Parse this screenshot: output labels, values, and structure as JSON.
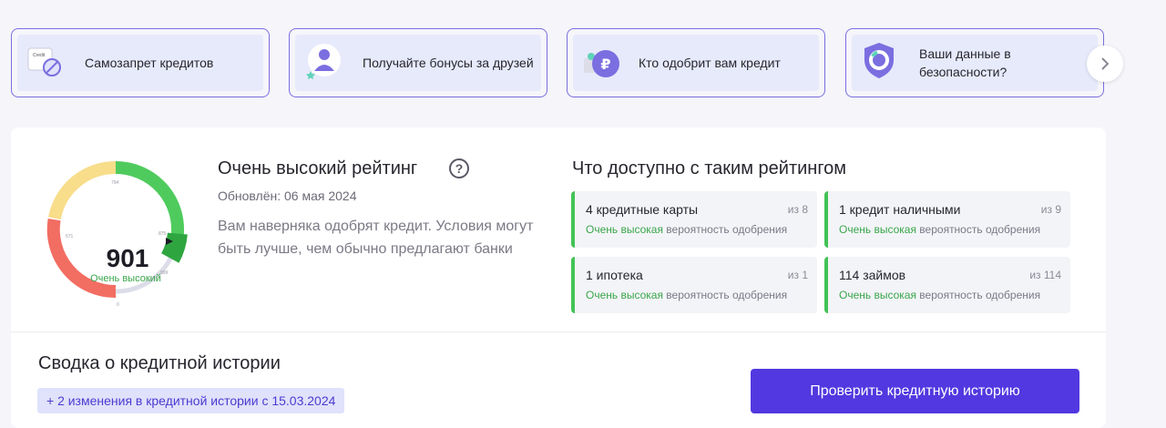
{
  "cards": [
    {
      "icon": "credit-ban-icon",
      "label": "Самозапрет кредитов"
    },
    {
      "icon": "user-bonus-icon",
      "label": "Получайте бонусы за друзей"
    },
    {
      "icon": "ruble-coin-icon",
      "label": "Кто одобрит вам кредит"
    },
    {
      "icon": "shield-icon",
      "label": "Ваши данные в безопасности?"
    }
  ],
  "card_icon_text": "Credit",
  "score": {
    "value": "901",
    "label": "Очень высокий",
    "max_scale": 999,
    "scale_ticks": [
      "0",
      "571",
      "794",
      "875",
      "999"
    ]
  },
  "rating": {
    "title": "Очень высокий рейтинг",
    "help": "?",
    "updated": "Обновлён: 06 мая 2024",
    "description": "Вам наверняка одобрят кредит. Условия могут быть лучше, чем обычно предлагают банки"
  },
  "available": {
    "title": "Что доступно с таким рейтингом",
    "offers": [
      {
        "name": "4 кредитные карты",
        "of": "из 8",
        "prob_high": "Очень высокая",
        "prob_rest": " вероятность одобрения"
      },
      {
        "name": "1 кредит наличными",
        "of": "из 9",
        "prob_high": "Очень высокая",
        "prob_rest": " вероятность одобрения"
      },
      {
        "name": "1 ипотека",
        "of": "из 1",
        "prob_high": "Очень высокая",
        "prob_rest": " вероятность одобрения"
      },
      {
        "name": "114 займов",
        "of": "из 114",
        "prob_high": "Очень высокая",
        "prob_rest": " вероятность одобрения"
      }
    ]
  },
  "summary": {
    "title": "Сводка о кредитной истории",
    "changes": "+ 2 изменения в кредитной истории с 15.03.2024",
    "button": "Проверить кредитную историю"
  },
  "colors": {
    "accent": "#5138e0",
    "card_border": "#7b6ee0",
    "gauge_red": "#f26d62",
    "gauge_yellow": "#f8dd8a",
    "gauge_green": "#4fcb5d",
    "gauge_grey": "#dcdde8",
    "high_prob": "#3aa64b"
  }
}
